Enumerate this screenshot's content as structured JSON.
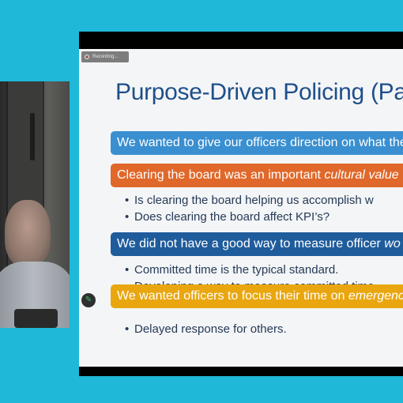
{
  "recording": {
    "label": "Recording..."
  },
  "slide": {
    "title": "Purpose-Driven Policing (Pa",
    "bars": [
      {
        "text": "We wanted to give our officers direction on what the",
        "italic": ""
      },
      {
        "text": "Clearing the board was an important ",
        "italic": "cultural value"
      },
      {
        "text": "We did not have a good way to measure officer ",
        "italic": "wo"
      },
      {
        "text": "We wanted officers to focus their time on ",
        "italic": "emergenc"
      }
    ],
    "bullets": [
      "Is clearing the board helping us accomplish w",
      "Does clearing the board affect KPI’s?",
      "Committed time is the typical standard.",
      "Developing a way to measure committed time",
      "Delayed response for others."
    ]
  },
  "colors": {
    "background": "#1fb8d8",
    "title": "#1d4f8a",
    "bar_blue": "#3a8fd0",
    "bar_orange": "#e0682a",
    "bar_navy": "#1f5c9c",
    "bar_gold": "#e9a60f"
  },
  "icons": {
    "pen_tool": "pen-icon",
    "recording": "record-icon"
  }
}
